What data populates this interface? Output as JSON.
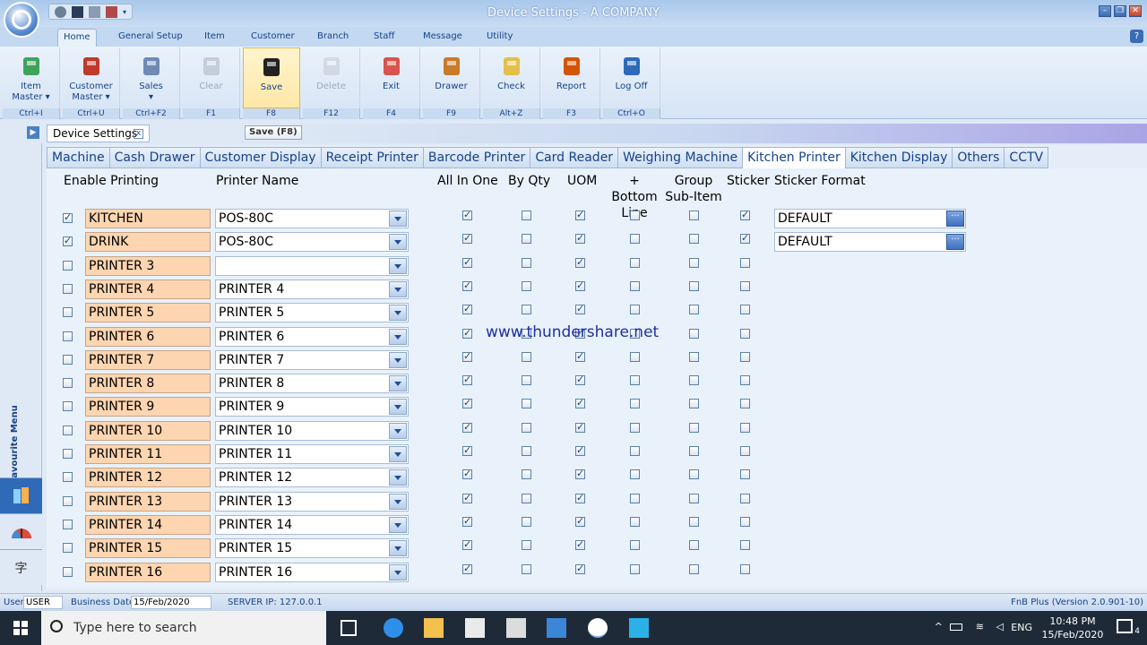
{
  "window": {
    "title_prefix": "Device Settings - ",
    "title_company": "A COMPANY"
  },
  "ribbon_tabs": [
    "Home",
    "General Setup",
    "Item",
    "Customer",
    "Branch",
    "Staff",
    "Message",
    "Utility"
  ],
  "ribbon_buttons": [
    {
      "label": "Item\nMaster ▾",
      "shortcut": "Ctrl+I",
      "icon": "item-master-icon",
      "enabled": true
    },
    {
      "label": "Customer\nMaster ▾",
      "shortcut": "Ctrl+U",
      "icon": "customer-master-icon",
      "enabled": true
    },
    {
      "label": "Sales\n▾",
      "shortcut": "Ctrl+F2",
      "icon": "shopping-cart-icon",
      "enabled": true
    },
    {
      "label": "Clear",
      "shortcut": "F1",
      "icon": "clear-icon",
      "enabled": false
    },
    {
      "label": "Save",
      "shortcut": "F8",
      "icon": "floppy-disk-icon",
      "enabled": true
    },
    {
      "label": "Delete",
      "shortcut": "F12",
      "icon": "trash-icon",
      "enabled": false
    },
    {
      "label": "Exit",
      "shortcut": "F4",
      "icon": "exit-icon",
      "enabled": true
    },
    {
      "label": "Drawer",
      "shortcut": "F9",
      "icon": "drawer-icon",
      "enabled": true
    },
    {
      "label": "Check",
      "shortcut": "Alt+Z",
      "icon": "checklist-icon",
      "enabled": true
    },
    {
      "label": "Report",
      "shortcut": "F3",
      "icon": "report-icon",
      "enabled": true
    },
    {
      "label": "Log Off",
      "shortcut": "Ctrl+O",
      "icon": "padlock-icon",
      "enabled": true
    }
  ],
  "doc_tab": {
    "label": "Device Settings",
    "close": "x"
  },
  "tooltip": "Save (F8)",
  "fav_menu_label": "My Favourite Menu",
  "sub_tabs": [
    "Machine",
    "Cash Drawer",
    "Customer Display",
    "Receipt Printer",
    "Barcode Printer",
    "Card Reader",
    "Weighing Machine",
    "Kitchen Printer",
    "Kitchen Display",
    "Others",
    "CCTV"
  ],
  "active_sub_tab": "Kitchen Printer",
  "headers": {
    "enable_printing": "Enable Printing",
    "printer_name": "Printer Name",
    "all_in_one": "All In One",
    "by_qty": "By Qty",
    "uom": "UOM",
    "bottom_line_1": "+ Bottom",
    "bottom_line_2": "Line",
    "group_1": "Group",
    "group_2": "Sub-Item",
    "sticker": "Sticker",
    "sticker_format": "Sticker Format"
  },
  "rows": [
    {
      "enabled": true,
      "name": "KITCHEN",
      "printer": "POS-80C",
      "all_in_one": true,
      "by_qty": false,
      "uom": true,
      "bottom_line": false,
      "group": false,
      "sticker": true,
      "sticker_format": "DEFAULT"
    },
    {
      "enabled": true,
      "name": "DRINK",
      "printer": "POS-80C",
      "all_in_one": true,
      "by_qty": false,
      "uom": true,
      "bottom_line": false,
      "group": false,
      "sticker": true,
      "sticker_format": "DEFAULT"
    },
    {
      "enabled": false,
      "name": "PRINTER 3",
      "printer": "",
      "all_in_one": true,
      "by_qty": false,
      "uom": true,
      "bottom_line": false,
      "group": false,
      "sticker": false
    },
    {
      "enabled": false,
      "name": "PRINTER 4",
      "printer": "PRINTER 4",
      "all_in_one": true,
      "by_qty": false,
      "uom": true,
      "bottom_line": false,
      "group": false,
      "sticker": false
    },
    {
      "enabled": false,
      "name": "PRINTER 5",
      "printer": "PRINTER 5",
      "all_in_one": true,
      "by_qty": false,
      "uom": true,
      "bottom_line": false,
      "group": false,
      "sticker": false
    },
    {
      "enabled": false,
      "name": "PRINTER 6",
      "printer": "PRINTER 6",
      "all_in_one": true,
      "by_qty": false,
      "uom": true,
      "bottom_line": false,
      "group": false,
      "sticker": false
    },
    {
      "enabled": false,
      "name": "PRINTER 7",
      "printer": "PRINTER 7",
      "all_in_one": true,
      "by_qty": false,
      "uom": true,
      "bottom_line": false,
      "group": false,
      "sticker": false
    },
    {
      "enabled": false,
      "name": "PRINTER 8",
      "printer": "PRINTER 8",
      "all_in_one": true,
      "by_qty": false,
      "uom": true,
      "bottom_line": false,
      "group": false,
      "sticker": false
    },
    {
      "enabled": false,
      "name": "PRINTER 9",
      "printer": "PRINTER 9",
      "all_in_one": true,
      "by_qty": false,
      "uom": true,
      "bottom_line": false,
      "group": false,
      "sticker": false
    },
    {
      "enabled": false,
      "name": "PRINTER 10",
      "printer": "PRINTER 10",
      "all_in_one": true,
      "by_qty": false,
      "uom": true,
      "bottom_line": false,
      "group": false,
      "sticker": false
    },
    {
      "enabled": false,
      "name": "PRINTER 11",
      "printer": "PRINTER 11",
      "all_in_one": true,
      "by_qty": false,
      "uom": true,
      "bottom_line": false,
      "group": false,
      "sticker": false
    },
    {
      "enabled": false,
      "name": "PRINTER 12",
      "printer": "PRINTER 12",
      "all_in_one": true,
      "by_qty": false,
      "uom": true,
      "bottom_line": false,
      "group": false,
      "sticker": false
    },
    {
      "enabled": false,
      "name": "PRINTER 13",
      "printer": "PRINTER 13",
      "all_in_one": true,
      "by_qty": false,
      "uom": true,
      "bottom_line": false,
      "group": false,
      "sticker": false
    },
    {
      "enabled": false,
      "name": "PRINTER 14",
      "printer": "PRINTER 14",
      "all_in_one": true,
      "by_qty": false,
      "uom": true,
      "bottom_line": false,
      "group": false,
      "sticker": false
    },
    {
      "enabled": false,
      "name": "PRINTER 15",
      "printer": "PRINTER 15",
      "all_in_one": true,
      "by_qty": false,
      "uom": true,
      "bottom_line": false,
      "group": false,
      "sticker": false
    },
    {
      "enabled": false,
      "name": "PRINTER 16",
      "printer": "PRINTER 16",
      "all_in_one": true,
      "by_qty": false,
      "uom": true,
      "bottom_line": false,
      "group": false,
      "sticker": false
    }
  ],
  "watermark": "www.thundershare.net",
  "status": {
    "user_label": "User",
    "user_value": "USER",
    "business_date_label": "Business Date",
    "business_date_value": "15/Feb/2020",
    "server_ip": "SERVER IP: 127.0.0.1",
    "version": "FnB Plus (Version 2.0.901-10)"
  },
  "taskbar": {
    "search_placeholder": "Type here to search",
    "language": "ENG",
    "time": "10:48 PM",
    "date": "15/Feb/2020",
    "notifications": "4"
  },
  "colors": {
    "name_field_bg": "#fdd5b1",
    "accent": "#15428b",
    "taskbar": "#1f2a38"
  }
}
